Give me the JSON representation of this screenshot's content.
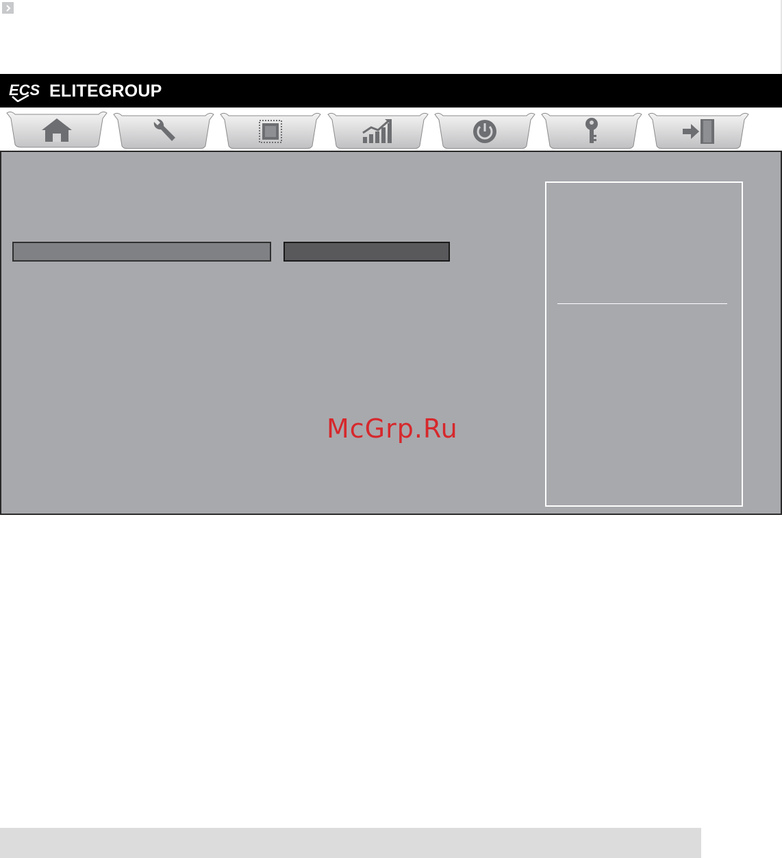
{
  "header": {
    "logo_mark": "ECS",
    "brand": "ELITEGROUP",
    "background": "#000000"
  },
  "tabs": [
    {
      "id": "main",
      "icon": "home-icon",
      "active": true
    },
    {
      "id": "advanced",
      "icon": "wrench-icon",
      "active": false
    },
    {
      "id": "chipset",
      "icon": "chip-icon",
      "active": false
    },
    {
      "id": "mib",
      "icon": "chart-icon",
      "active": false
    },
    {
      "id": "boot",
      "icon": "power-icon",
      "active": false
    },
    {
      "id": "security",
      "icon": "key-icon",
      "active": false
    },
    {
      "id": "exit",
      "icon": "exit-icon",
      "active": false
    }
  ],
  "panel": {
    "background": "#a8a9ad",
    "field_light_color": "#808184",
    "field_dark_color": "#59595c"
  },
  "watermark": "McGrp.Ru",
  "colors": {
    "watermark": "#d6282c",
    "footer": "#dcdcdd"
  }
}
